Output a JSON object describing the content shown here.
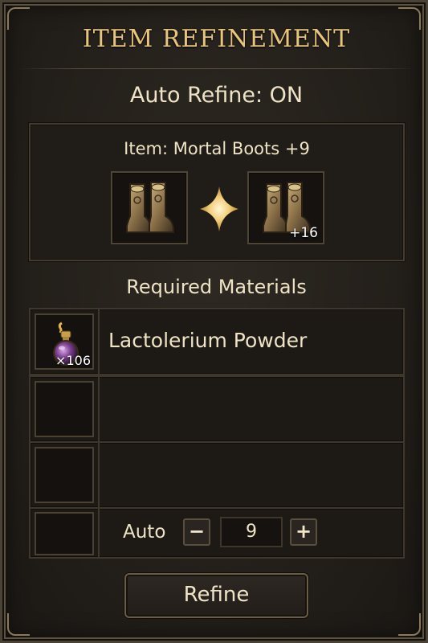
{
  "window": {
    "title": "ITEM REFINEMENT"
  },
  "auto_refine": {
    "status_text": "Auto Refine: ON"
  },
  "item": {
    "name_text": "Item: Mortal Boots +9",
    "source_icon": "boots-icon",
    "result_icon": "boots-icon",
    "result_badge": "+16"
  },
  "materials": {
    "section_title": "Required Materials",
    "rows": [
      {
        "icon": "potion-icon",
        "name": "Lactolerium Powder",
        "quantity": "×106"
      },
      {
        "icon": "",
        "name": "",
        "quantity": ""
      },
      {
        "icon": "",
        "name": "",
        "quantity": ""
      }
    ]
  },
  "auto_count": {
    "label": "Auto",
    "minus": "−",
    "plus": "+",
    "value": "9"
  },
  "actions": {
    "refine_label": "Refine"
  },
  "colors": {
    "title_gold": "#e8c57c",
    "text": "#efe3c6",
    "panel_bg": "#201c17",
    "border": "#4f4536"
  }
}
